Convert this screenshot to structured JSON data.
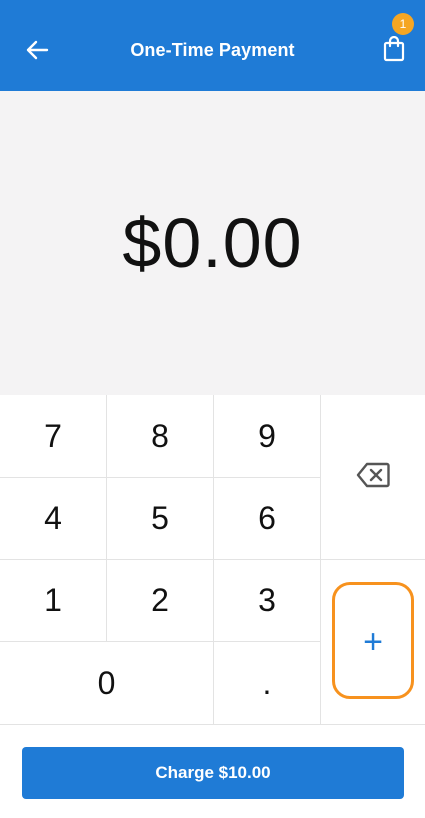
{
  "header": {
    "title": "One-Time Payment",
    "back_icon": "arrow-left-icon",
    "cart_icon": "shopping-bag-icon",
    "cart_badge": "1",
    "bg_color": "#1f7bd6",
    "badge_color": "#f5a623"
  },
  "amount": {
    "value": "$0.00"
  },
  "keypad": {
    "keys": [
      "7",
      "8",
      "9",
      "4",
      "5",
      "6",
      "1",
      "2",
      "3",
      "0",
      "."
    ],
    "backspace_icon": "backspace-icon",
    "plus_label": "+",
    "plus_highlight_color": "#f7921e"
  },
  "footer": {
    "charge_label": "Charge $10.00"
  }
}
